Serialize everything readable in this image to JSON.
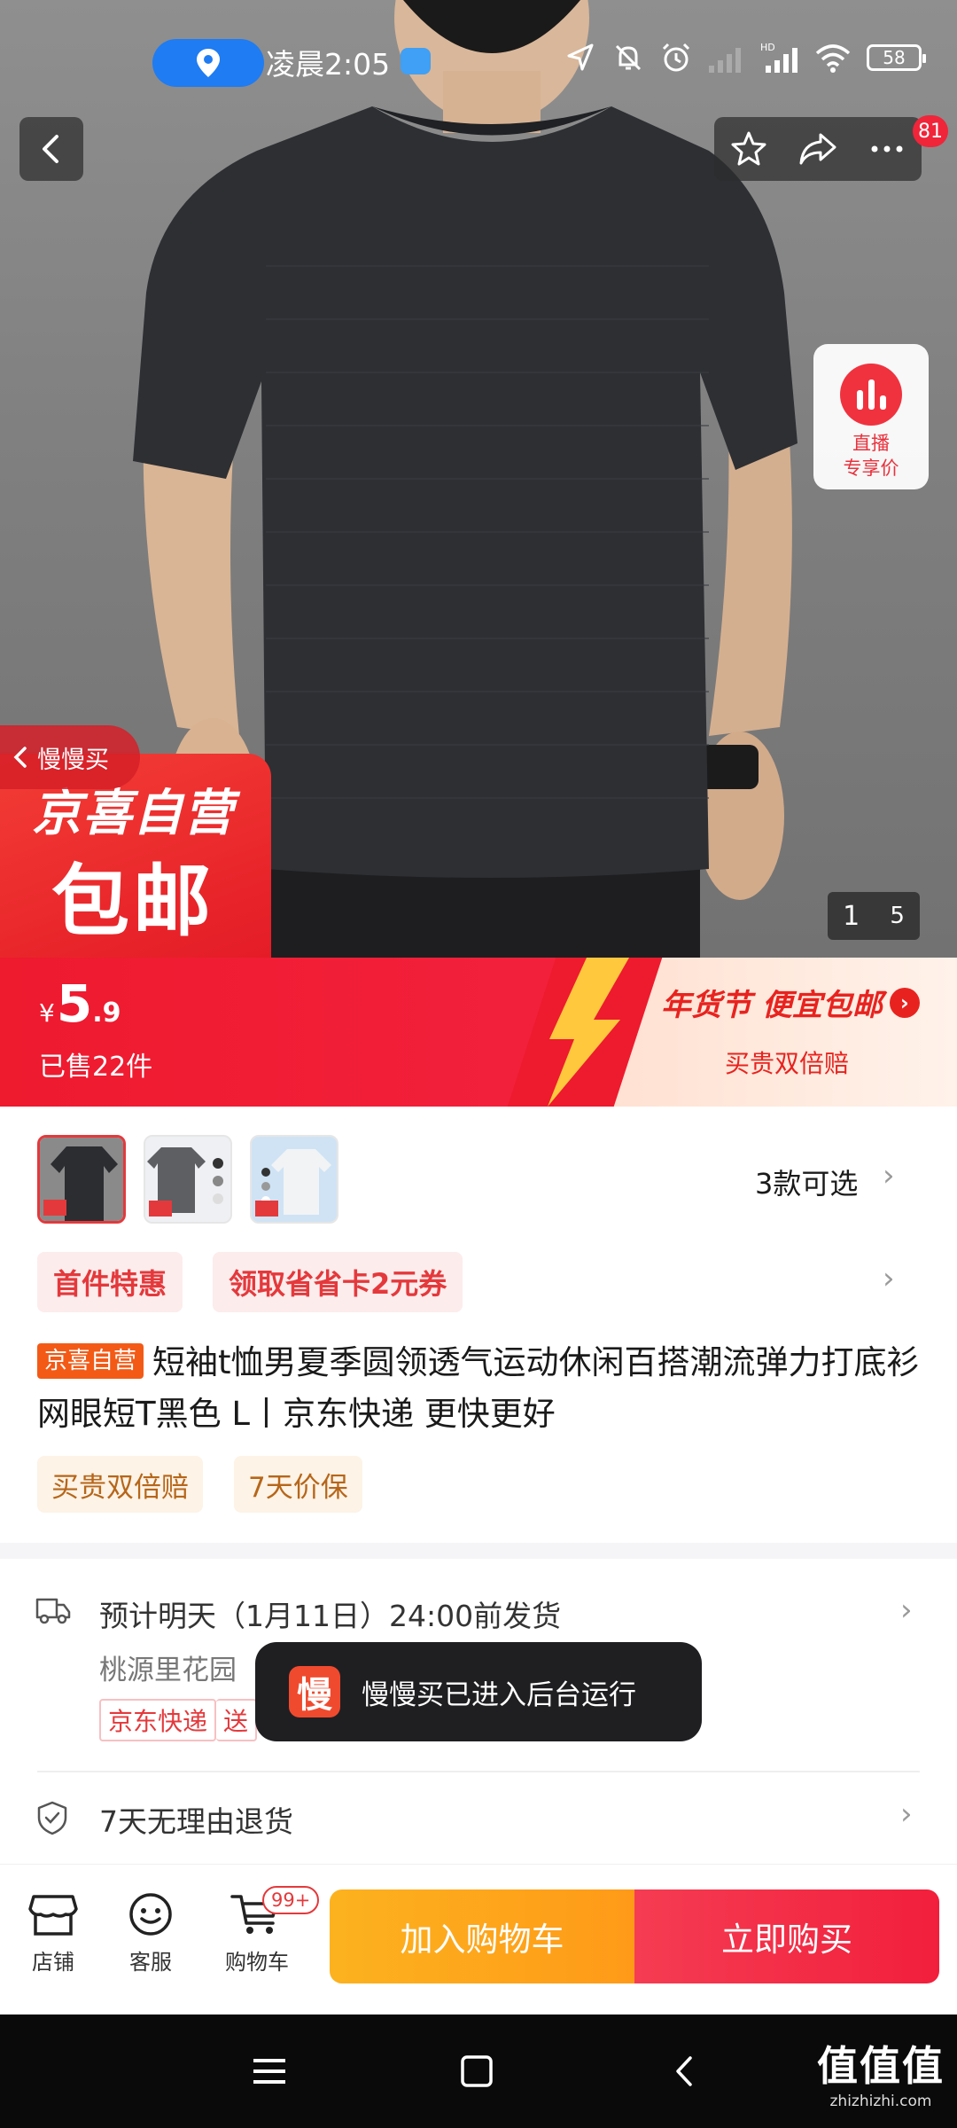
{
  "status_bar": {
    "time": "凌晨2:05",
    "battery": "58",
    "icons": [
      "location-pin-icon",
      "cloud-icon",
      "navigation-icon",
      "mute-icon",
      "alarm-icon",
      "signal-icon",
      "hd-signal-icon",
      "wifi-icon",
      "battery-icon"
    ]
  },
  "top_nav": {
    "icons": [
      "back-icon",
      "star-icon",
      "share-icon",
      "more-icon"
    ],
    "notification_count": "81"
  },
  "hero": {
    "live_card_line1": "直播",
    "live_card_line2": "专享价",
    "back_to_app": "慢慢买",
    "badge_line1": "京喜自营",
    "badge_line2": "包邮",
    "image_index": "1",
    "image_total": "5"
  },
  "price_banner": {
    "currency": "¥",
    "price_int": "5",
    "price_dec": ".9",
    "sold": "已售22件",
    "promo_title": "年货节 便宜包邮",
    "promo_sub": "买贵双倍赔"
  },
  "variants": {
    "count_label": "3款可选",
    "thumb_colors": [
      "#2b2d31",
      "#5d5f63",
      "#f2f3f5"
    ]
  },
  "coupons": [
    "首件特惠",
    "领取省省卡2元券"
  ],
  "product": {
    "tag": "京喜自营",
    "title": "短袖t恤男夏季圆领透气运动休闲百搭潮流弹力打底衫 网眼短T黑色 L丨京东快递 更快更好",
    "guarantees": [
      "买贵双倍赔",
      "7天价保"
    ]
  },
  "delivery": {
    "main": "预计明天（1月11日）24:00前发货",
    "address": "桃源里花园",
    "tags": [
      "京东快递",
      "送"
    ]
  },
  "returns": {
    "label": "7天无理由退货"
  },
  "toast": {
    "icon_char": "慢",
    "text": "慢慢买已进入后台运行"
  },
  "action_bar": {
    "shop": "店铺",
    "service": "客服",
    "cart": "购物车",
    "cart_badge": "99+",
    "add_to_cart": "加入购物车",
    "buy_now": "立即购买"
  },
  "watermark": {
    "line1": "值值值",
    "line2": "zhizhizhi.com"
  },
  "colors": {
    "jd_red": "#e4393c",
    "banner_red": "#ee1a2e",
    "orange": "#ff9a18"
  }
}
